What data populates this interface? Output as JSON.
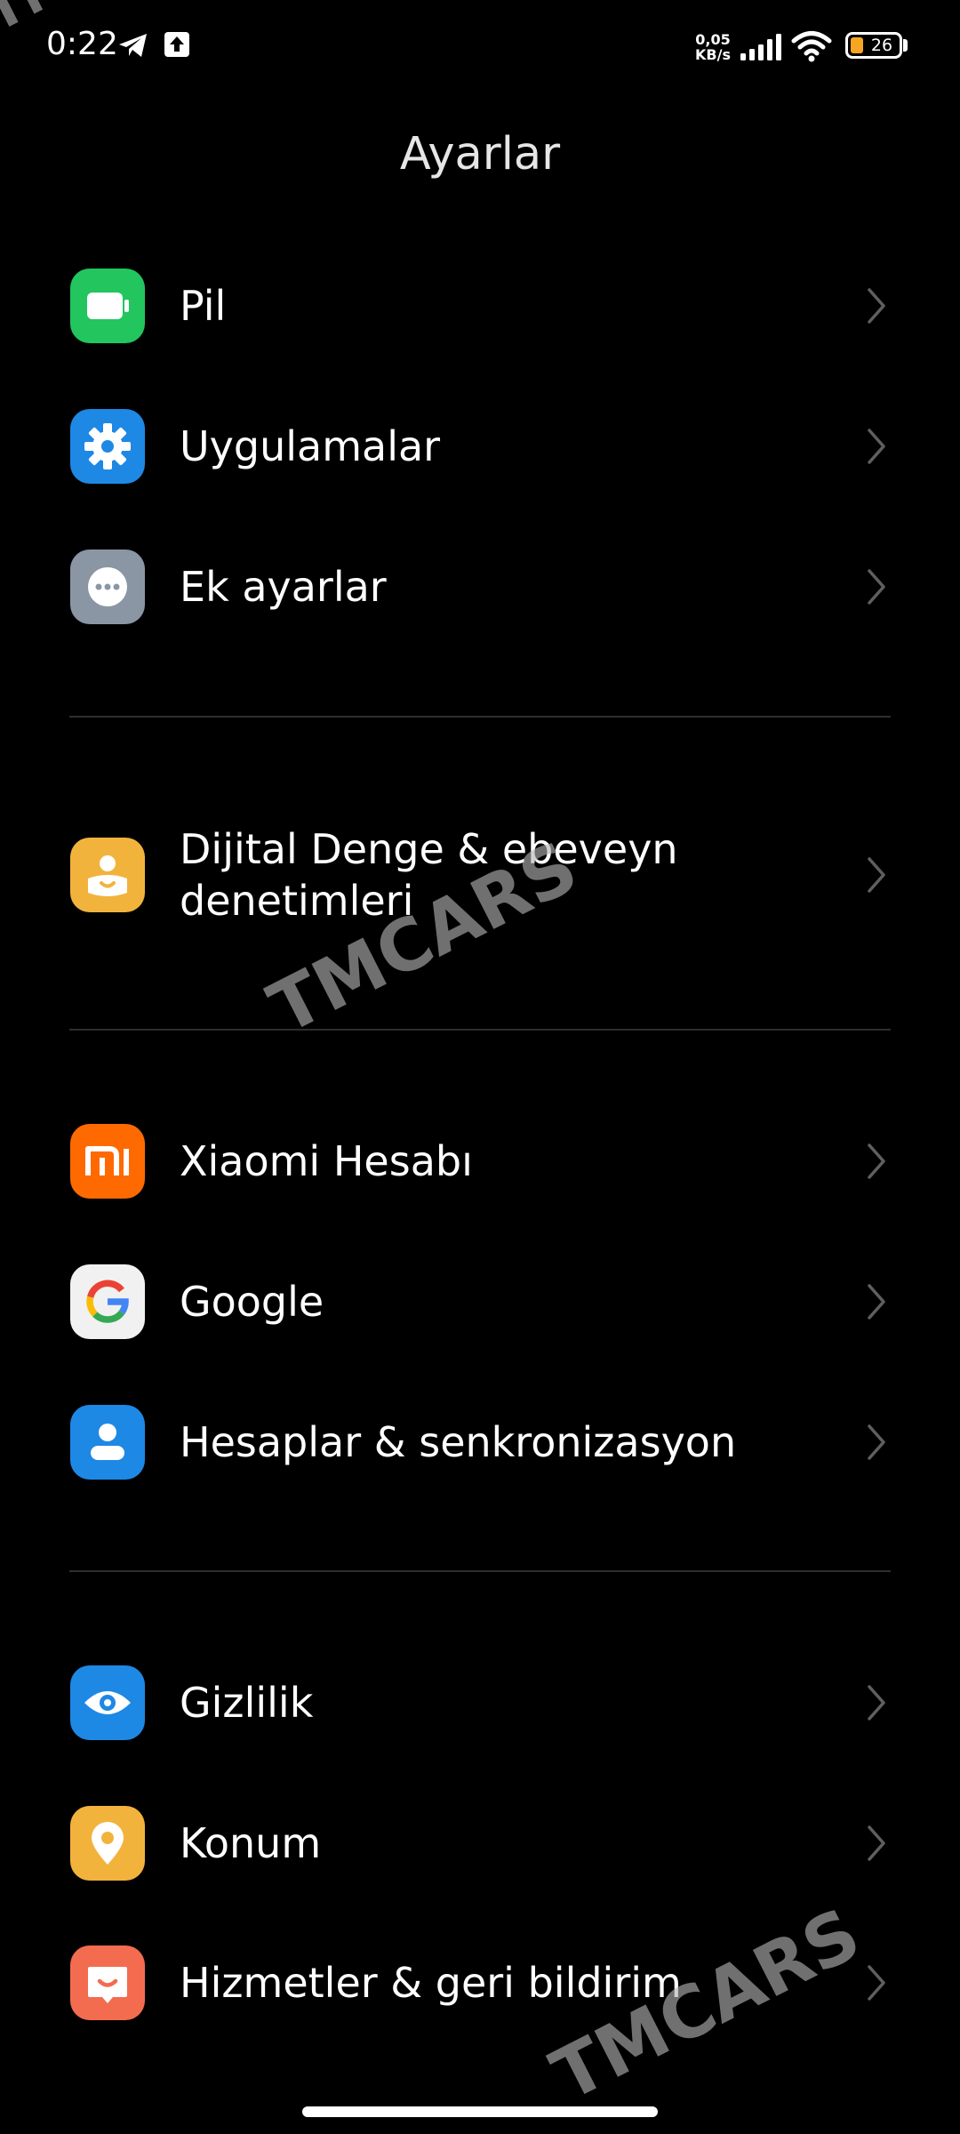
{
  "status_bar": {
    "time": "0:22",
    "net_speed_value": "0,05",
    "net_speed_unit": "KB/s",
    "battery_level": "26"
  },
  "header": {
    "title": "Ayarlar"
  },
  "settings": {
    "items": [
      {
        "label": "Pil",
        "icon": "battery-icon",
        "color": "#22c55e"
      },
      {
        "label": "Uygulamalar",
        "icon": "apps-gear-icon",
        "color": "#1e88e5"
      },
      {
        "label": "Ek ayarlar",
        "icon": "more-dots-icon",
        "color": "#8a96a3"
      },
      {
        "label": "Dijital Denge & ebeveyn denetimleri",
        "icon": "digital-wellbeing-icon",
        "color": "#f2b33d"
      },
      {
        "label": "Xiaomi Hesabı",
        "icon": "mi-logo-icon",
        "color": "#ff6a00"
      },
      {
        "label": "Google",
        "icon": "google-g-icon",
        "color": "#f1f1f1"
      },
      {
        "label": "Hesaplar & senkronizasyon",
        "icon": "account-person-icon",
        "color": "#1e88e5"
      },
      {
        "label": "Gizlilik",
        "icon": "privacy-eye-icon",
        "color": "#1e88e5"
      },
      {
        "label": "Konum",
        "icon": "location-pin-icon",
        "color": "#f2b33d"
      },
      {
        "label": "Hizmetler & geri bildirim",
        "icon": "feedback-icon",
        "color": "#f36c4f"
      }
    ]
  },
  "watermark": {
    "text": "TMCARS"
  }
}
